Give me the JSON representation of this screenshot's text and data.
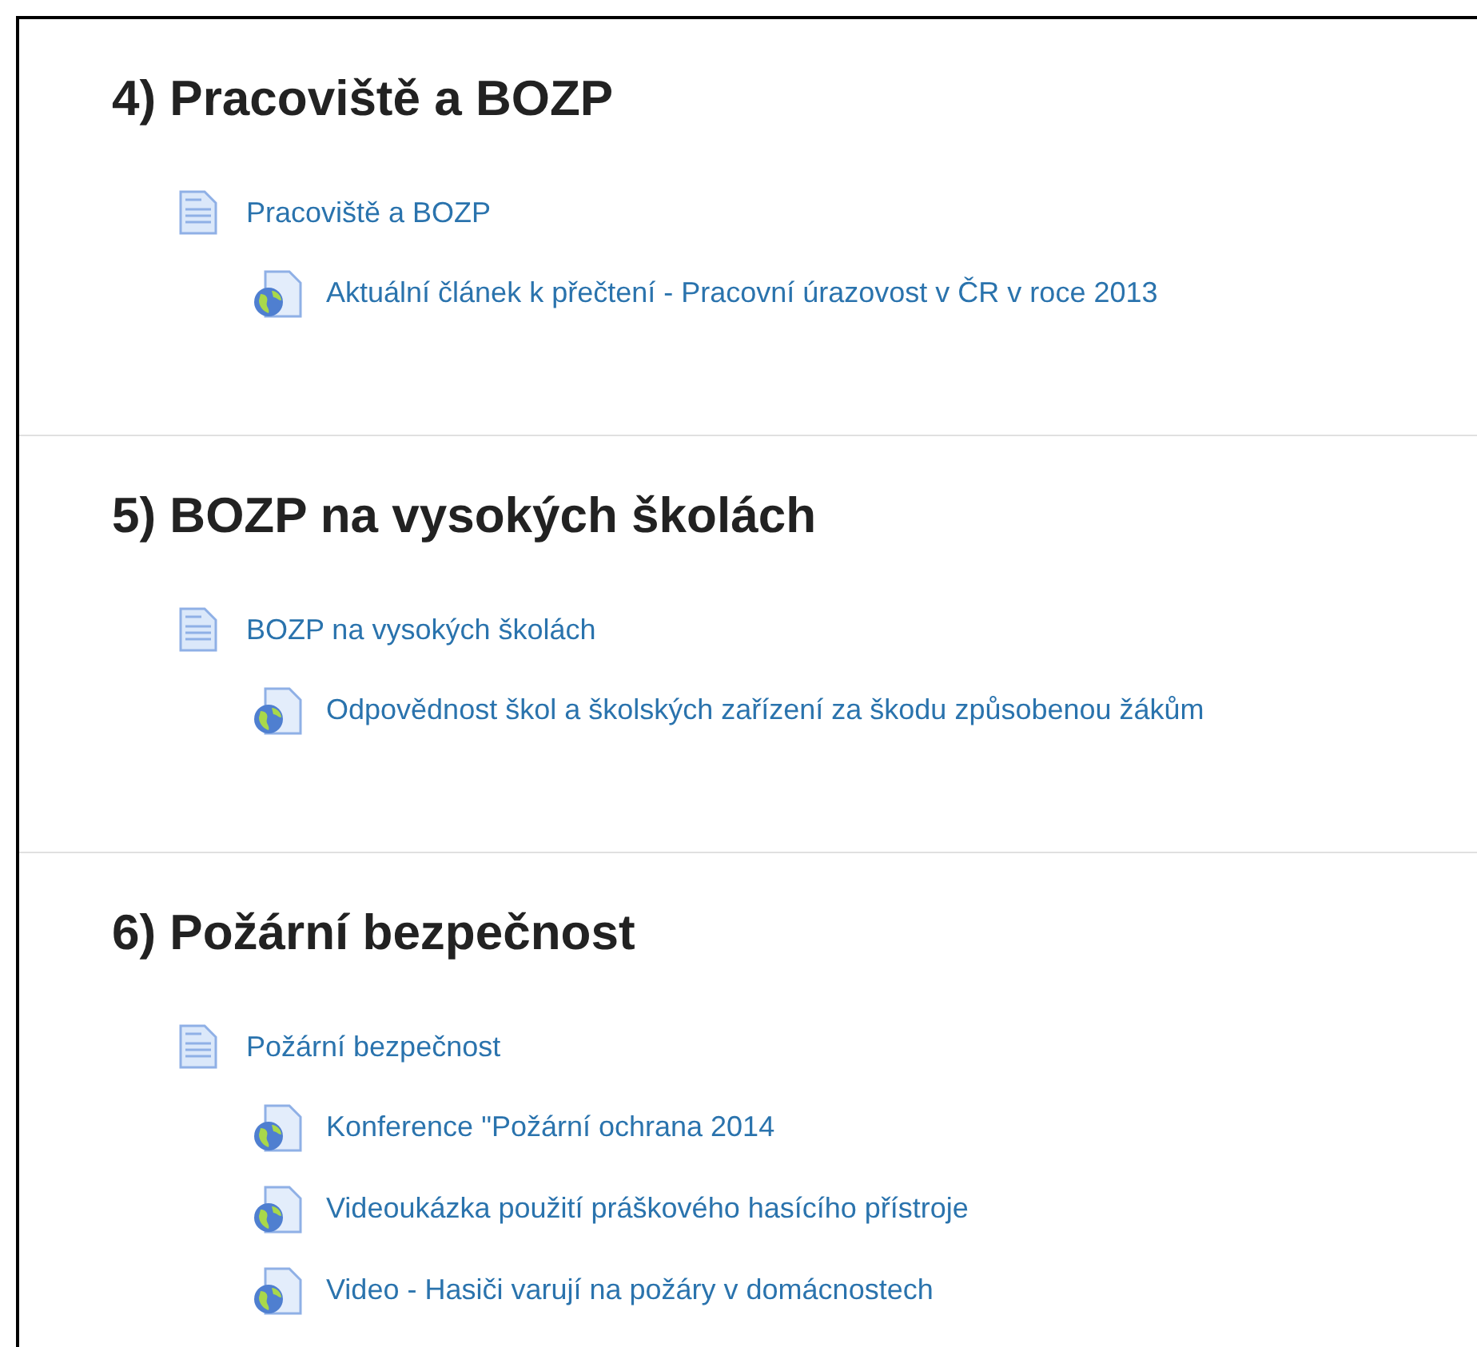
{
  "sections": [
    {
      "title": "4) Pracoviště a BOZP",
      "page": {
        "label": "Pracoviště a BOZP",
        "links": [
          "Aktuální článek k přečtení - Pracovní úrazovost v ČR v roce 2013"
        ]
      }
    },
    {
      "title": "5) BOZP na vysokých školách",
      "page": {
        "label": "BOZP na vysokých školách",
        "links": [
          "Odpovědnost škol a školských zařízení za škodu způsobenou žákům"
        ]
      }
    },
    {
      "title": "6) Požární bezpečnost",
      "page": {
        "label": "Požární bezpečnost",
        "links": [
          "Konference \"Požární ochrana 2014",
          "Videoukázka použití práškového hasícího přístroje",
          "Video - Hasiči varují na požáry v domácnostech"
        ]
      }
    }
  ]
}
